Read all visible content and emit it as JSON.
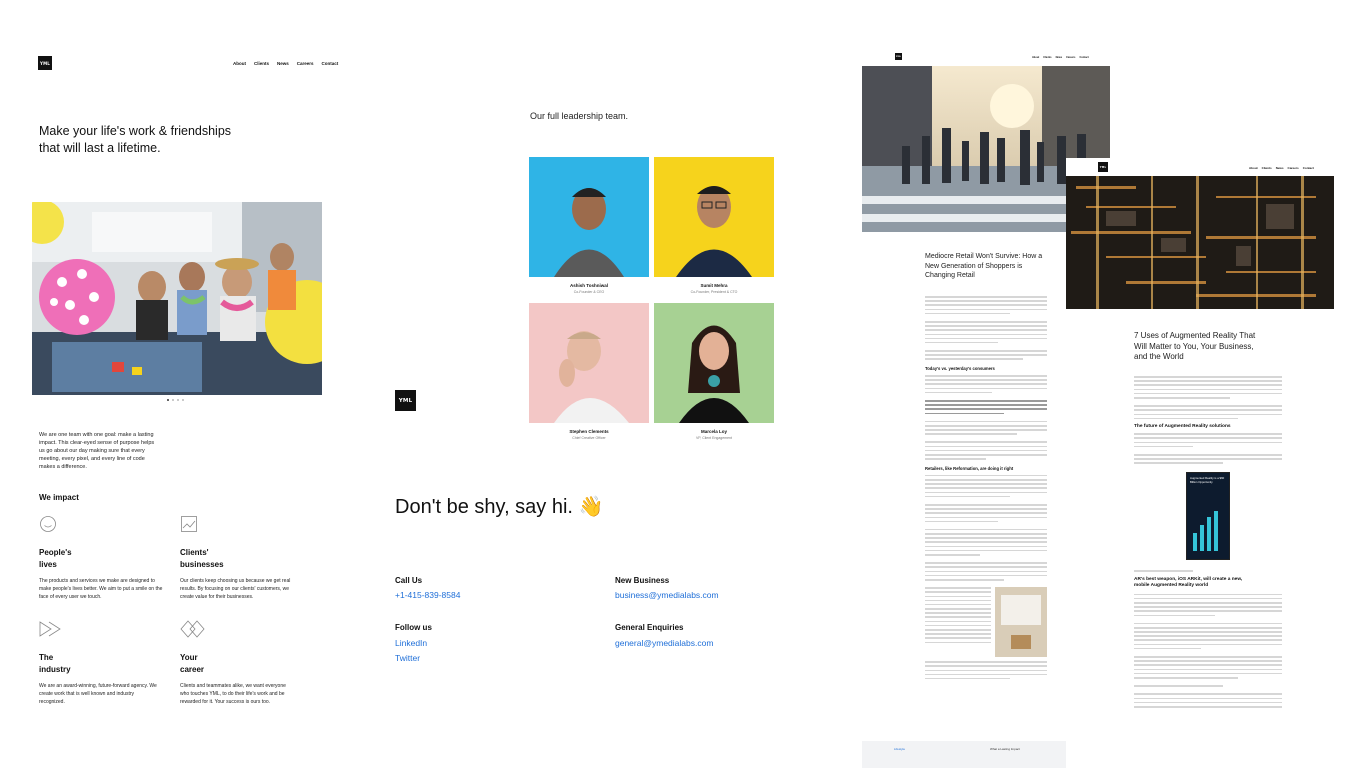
{
  "left_page": {
    "logo": "YML",
    "nav": [
      "About",
      "Clients",
      "News",
      "Careers",
      "Contact"
    ],
    "hero_line1": "Make your life's work & friendships",
    "hero_line2": "that will last a lifetime.",
    "intro": "We are one team with one goal: make a lasting impact. This clear-eyed sense of purpose helps us go about our day making sure that every meeting, every pixel, and every line of code makes a difference.",
    "impact_heading": "We impact",
    "impacts": [
      {
        "title1": "People's",
        "title2": "lives",
        "icon": "smiley-face-icon",
        "text": "The products and services we make are designed to make people's lives better. We aim to put a smile on the face of every user we touch."
      },
      {
        "title1": "Clients'",
        "title2": "businesses",
        "icon": "growth-chart-icon",
        "text": "Our clients keep choosing us because we get real results. By focusing on our clients' customers, we create value for their businesses."
      },
      {
        "title1": "The",
        "title2": "industry",
        "icon": "forward-arrows-icon",
        "text": "We are an award-winning, future-forward agency. We create work that is well known and industry recognized."
      },
      {
        "title1": "Your",
        "title2": "career",
        "icon": "diamond-shapes-icon",
        "text": "Clients and teammates alike, we want everyone who touches YML, to do their life's work and be rewarded for it. Your success is ours too."
      }
    ]
  },
  "middle_page": {
    "leadership_title": "Our full leadership team.",
    "leaders": [
      {
        "name": "Ashish Toshniwal",
        "role": "Co-Founder & CEO",
        "bg": "#2fb4e6"
      },
      {
        "name": "Sumit Mehra",
        "role": "Co-Founder, President & CTO",
        "bg": "#f6d31c"
      },
      {
        "name": "Stephen Clements",
        "role": "Chief Creative Officer",
        "bg": "#f3c7c6"
      },
      {
        "name": "Marcela Loy",
        "role": "VP, Client Engagement",
        "bg": "#a7d193"
      }
    ],
    "logo": "YML",
    "contact_heading": "Don't be shy, say hi. 👋",
    "call_us_label": "Call Us",
    "phone": "+1-415-839-8584",
    "new_business_label": "New Business",
    "new_business_email": "business@ymedialabs.com",
    "follow_us_label": "Follow us",
    "linkedin": "LinkedIn",
    "twitter": "Twitter",
    "general_label": "General Enquiries",
    "general_email": "general@ymedialabs.com"
  },
  "article_one": {
    "logo": "YML",
    "nav": [
      "About",
      "Clients",
      "News",
      "Careers",
      "Contact"
    ],
    "title": "Mediocre Retail Won't Survive: How a New Generation of Shoppers is Changing Retail",
    "subheading1": "Today's vs. yesterday's consumers",
    "subheading2": "Retailers, like Reformation, are doing it right",
    "footer_left": "Lifestyle",
    "footer_right": "What a Lasting Impact"
  },
  "article_two": {
    "logo": "YML",
    "nav": [
      "About",
      "Clients",
      "News",
      "Careers",
      "Contact"
    ],
    "title": "7 Uses of Augmented Reality That Will Matter to You, Your Business, and the World",
    "subheading1": "The future of Augmented Reality solutions",
    "phone_caption": "Augmented Reality is a $60 Billion Opportunity",
    "subheading2": "AR's best weapon, iOS ARKit, will create a new, mobile Augmented Reality world"
  },
  "colors": {
    "accent_blue": "#1f6fd8",
    "text": "#111111",
    "leader_blue": "#2fb4e6",
    "leader_yellow": "#f6d31c",
    "leader_pink": "#f3c7c6",
    "leader_green": "#a7d193"
  }
}
